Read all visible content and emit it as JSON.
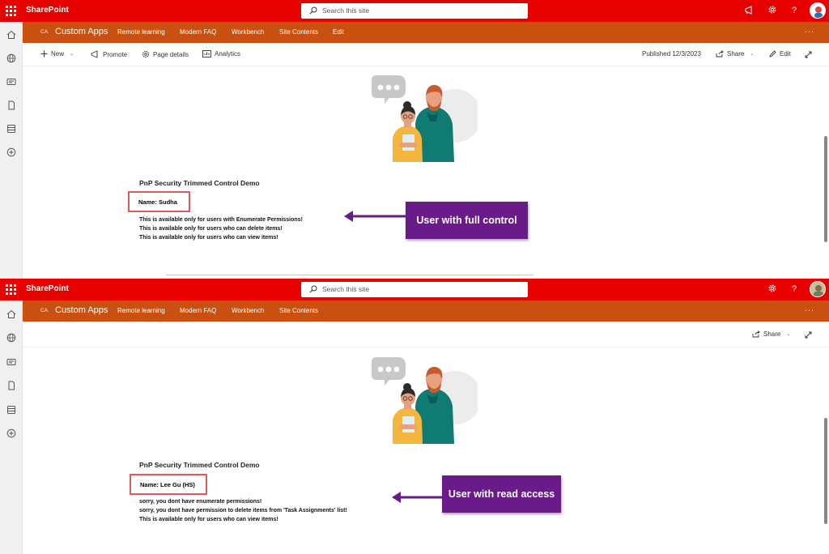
{
  "app_name": "SharePoint",
  "search_placeholder": "Search this site",
  "site": {
    "initials": "CA",
    "title": "Custom Apps",
    "nav_full": [
      "Remote learning",
      "Modern FAQ",
      "Workbench",
      "Site Contents",
      "Edit"
    ],
    "nav_read": [
      "Remote learning",
      "Modern FAQ",
      "Workbench",
      "Site Contents"
    ],
    "more": "..."
  },
  "command_bar": {
    "new": "New",
    "promote": "Promote",
    "page_details": "Page details",
    "analytics": "Analytics",
    "published": "Published 12/3/2023",
    "share": "Share",
    "edit": "Edit"
  },
  "panel_full": {
    "webpart_title": "PnP Security Trimmed Control Demo",
    "name": "Name: Sudha",
    "lines": [
      "This is available only for users with Enumerate Permissions!",
      "This is available only for users who can delete items!",
      "This is available only for users who can view items!"
    ],
    "callout": "User with full control"
  },
  "panel_read": {
    "webpart_title": "PnP Security Trimmed Control Demo",
    "name": "Name: Lee Gu (HS)",
    "lines": [
      "sorry, you dont have enumerate permissions!",
      "sorry, you dont have permission to delete items from 'Task Assignments' list!",
      "This is available only for users who can view items!"
    ],
    "callout": "User with read access"
  },
  "colors": {
    "suite_bar": "#e60000",
    "hub_nav": "#ca5010",
    "callout": "#6a1b8a",
    "highlight_box": "#e05a5a"
  },
  "icons": [
    "waffle-icon",
    "search-icon",
    "megaphone-icon",
    "gear-icon",
    "help-icon",
    "home-icon",
    "globe-icon",
    "news-icon",
    "document-icon",
    "list-icon",
    "add-icon",
    "plus-icon",
    "promote-icon",
    "page-details-icon",
    "analytics-icon",
    "share-icon",
    "edit-icon",
    "expand-icon"
  ]
}
